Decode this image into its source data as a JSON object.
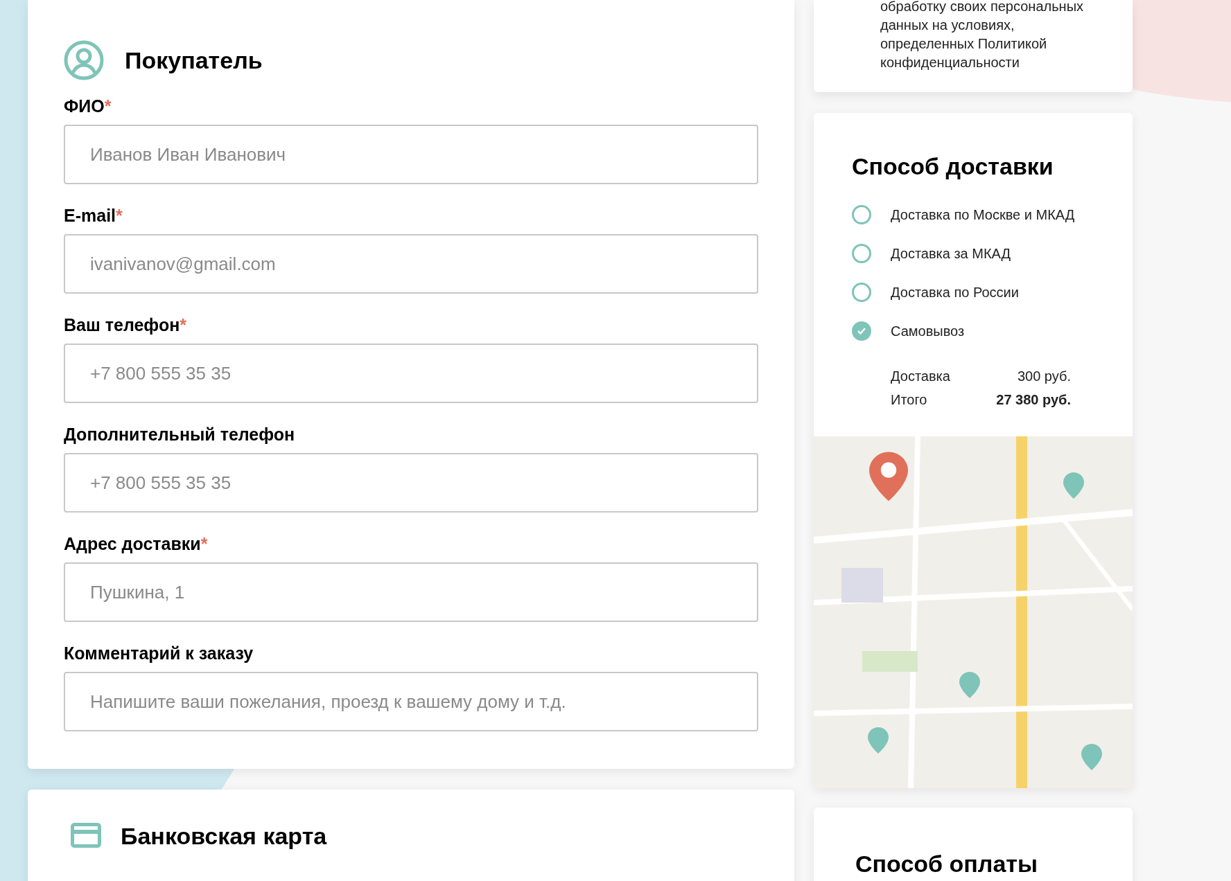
{
  "consent": {
    "text": "обработку своих персональных данных на условиях, определенных Политикой конфиденциальности"
  },
  "buyer": {
    "title": "Покупатель",
    "fields": [
      {
        "label": "ФИО",
        "asterisk": "*",
        "placeholder": "Иванов Иван Иванович"
      },
      {
        "label": "E-mail",
        "asterisk": "*",
        "placeholder": "ivanivanov@gmail.com"
      },
      {
        "label": "Ваш телефон",
        "asterisk": "*",
        "placeholder": "+7 800 555 35 35"
      },
      {
        "label": "Дополнительный телефон",
        "placeholder": "+7 800 555 35 35"
      },
      {
        "label": "Адрес доставки",
        "asterisk": "*",
        "placeholder": "Пушкина, 1"
      },
      {
        "label": "Комментарий к заказу",
        "placeholder": "Напишите ваши пожелания, проезд к вашему дому и т.д."
      }
    ]
  },
  "delivery": {
    "title": "Способ доставки",
    "options": [
      {
        "label": "Доставка по Москве и МКАД",
        "selected": false
      },
      {
        "label": "Доставка за МКАД",
        "selected": false
      },
      {
        "label": "Доставка по России",
        "selected": false
      },
      {
        "label": "Самовывоз",
        "selected": true
      }
    ],
    "summary": [
      {
        "label": "Доставка",
        "value": "300 руб.",
        "bold": false
      },
      {
        "label": "Итого",
        "value": "27 380 руб.",
        "bold": true
      }
    ]
  },
  "card": {
    "title": "Банковская карта"
  },
  "payment": {
    "title": "Способ оплаты"
  }
}
